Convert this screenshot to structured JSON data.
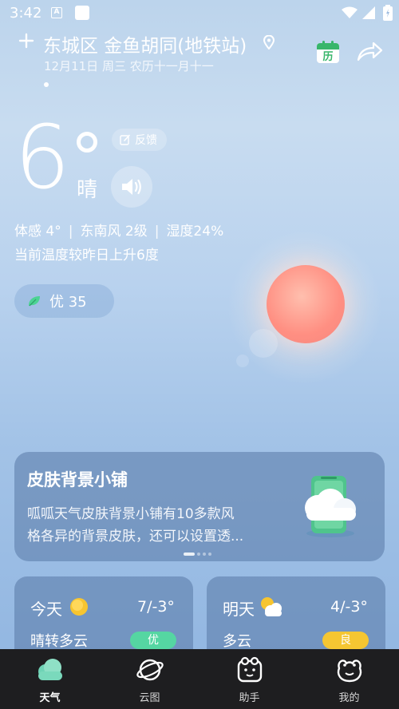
{
  "status_bar": {
    "time": "3:42",
    "a_icon_letter": "A"
  },
  "header": {
    "location": "东城区 金鱼胡同(地铁站)",
    "date": "12月11日 周三 农历十一月十一",
    "calendar_glyph": "历"
  },
  "current": {
    "temperature": "6",
    "condition": "晴",
    "feedback_label": "反馈",
    "feels_like": "体感 4°",
    "wind": "东南风 2级",
    "humidity": "湿度24%",
    "compare": "当前温度较昨日上升6度",
    "aqi_label": "优 35"
  },
  "shop_card": {
    "title": "皮肤背景小铺",
    "desc_line1": "呱呱天气皮肤背景小铺有10多款风",
    "desc_line2": "格各异的背景皮肤，还可以设置透..."
  },
  "forecast": [
    {
      "day": "今天",
      "range": "7/-3°",
      "desc": "晴转多云",
      "aqi": "优",
      "icon": "sun-icon",
      "badge_color": "#55d6a2"
    },
    {
      "day": "明天",
      "range": "4/-3°",
      "desc": "多云",
      "aqi": "良",
      "icon": "partly-cloudy-icon",
      "badge_color": "#f5c632"
    }
  ],
  "nav": [
    {
      "label": "天气",
      "icon": "cloud-icon",
      "active": true
    },
    {
      "label": "云图",
      "icon": "planet-icon",
      "active": false
    },
    {
      "label": "助手",
      "icon": "frog-assistant-icon",
      "active": false
    },
    {
      "label": "我的",
      "icon": "frog-face-icon",
      "active": false
    }
  ]
}
